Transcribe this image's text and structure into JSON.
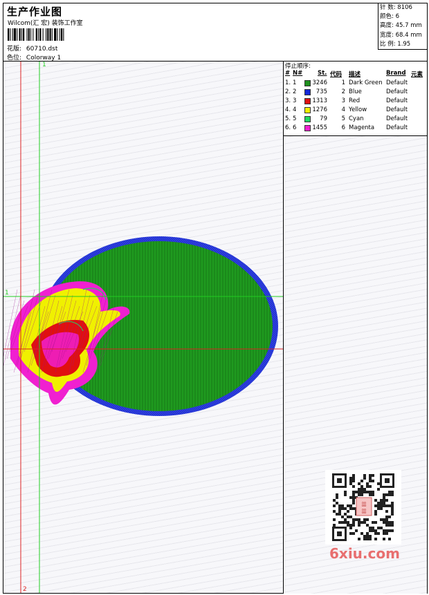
{
  "header": {
    "title": "生产作业图",
    "company": "Wilcom(汇 宏) 装饰工作室",
    "design_label": "花版:",
    "design_value": "60710.dst",
    "colorway_label": "色位:",
    "colorway_value": "Colorway 1"
  },
  "stats": {
    "stitches_label": "针 数:",
    "stitches_value": "8106",
    "colors_label": "颜色:",
    "colors_value": "6",
    "height_label": "高度:",
    "height_value": "45.7 mm",
    "width_label": "宽度:",
    "width_value": "68.4 mm",
    "ratio_label": "比 例:",
    "ratio_value": "1.95"
  },
  "color_table": {
    "title": "停止顺序:",
    "headers": {
      "index": "#",
      "number": "N#",
      "stitches": "St.",
      "code": "代码",
      "description": "描述",
      "brand": "Brand",
      "element": "元素"
    },
    "rows": [
      {
        "index": "1.",
        "number": "1",
        "color": "#1e8f1e",
        "stitches": "3246",
        "code": "1",
        "description": "Dark Green",
        "brand": "Default"
      },
      {
        "index": "2.",
        "number": "2",
        "color": "#1428d8",
        "stitches": "735",
        "code": "2",
        "description": "Blue",
        "brand": "Default"
      },
      {
        "index": "3.",
        "number": "3",
        "color": "#e01010",
        "stitches": "1313",
        "code": "3",
        "description": "Red",
        "brand": "Default"
      },
      {
        "index": "4.",
        "number": "4",
        "color": "#f0f000",
        "stitches": "1276",
        "code": "4",
        "description": "Yellow",
        "brand": "Default"
      },
      {
        "index": "5.",
        "number": "5",
        "color": "#20d860",
        "stitches": "79",
        "code": "5",
        "description": "Cyan",
        "brand": "Default"
      },
      {
        "index": "6.",
        "number": "6",
        "color": "#f020d0",
        "stitches": "1455",
        "code": "6",
        "description": "Magenta",
        "brand": "Default"
      }
    ]
  },
  "guides": {
    "green_top_label": "1",
    "green_left_label": "1",
    "red_bottom_label": "2"
  },
  "watermark": "6xiu.com",
  "colors": {
    "guide_green": "#22cc22",
    "guide_red": "#dd2222",
    "ellipse_fill": "#1f9a1f",
    "ellipse_border": "#1f2fd0",
    "flower_magenta": "#f020d0",
    "flower_yellow": "#f0f000",
    "flower_red": "#e01010"
  }
}
